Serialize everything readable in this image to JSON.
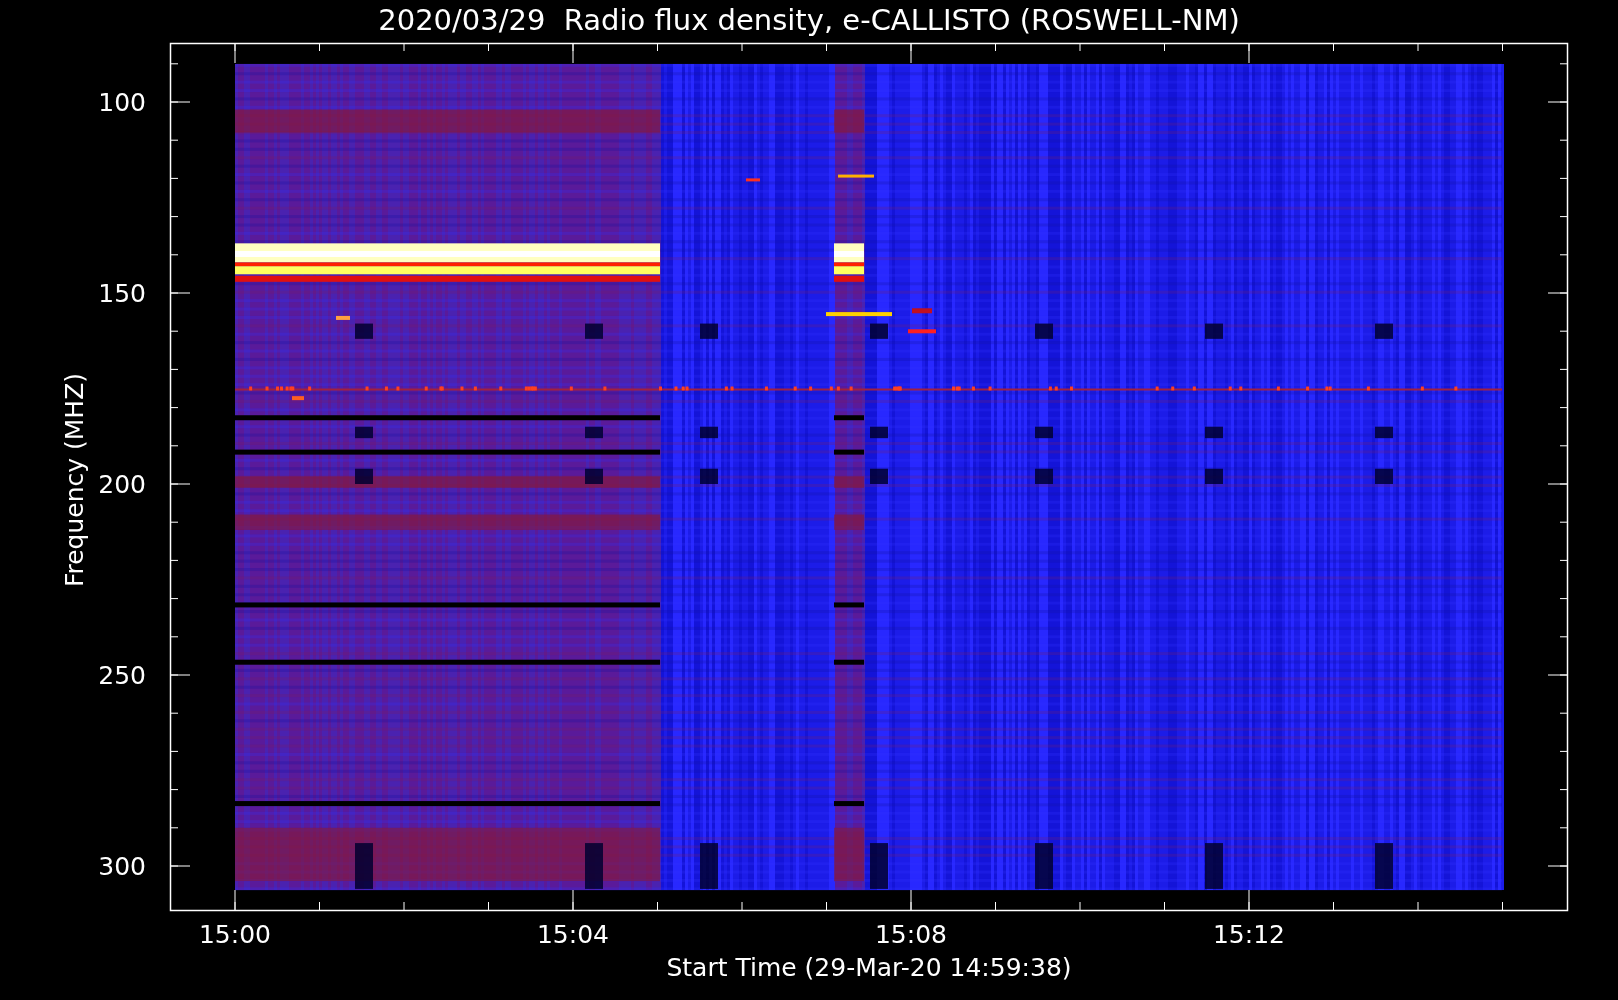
{
  "title": "2020/03/29  Radio flux density, e-CALLISTO (ROSWELL-NM)",
  "y_axis": {
    "label": "Frequency (MHZ)",
    "ticks": [
      "100",
      "150",
      "200",
      "250",
      "300"
    ]
  },
  "x_axis": {
    "label": "Start Time (29-Mar-20 14:59:38)",
    "ticks": [
      "15:00",
      "15:04",
      "15:08",
      "15:12"
    ]
  }
}
